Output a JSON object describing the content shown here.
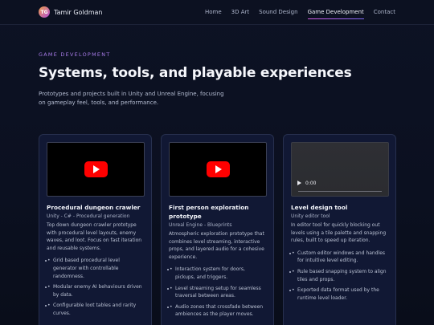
{
  "brand": {
    "initials": "TG",
    "name": "Tamir Goldman"
  },
  "nav": {
    "items": [
      {
        "label": "Home",
        "active": false
      },
      {
        "label": "3D Art",
        "active": false
      },
      {
        "label": "Sound Design",
        "active": false
      },
      {
        "label": "Game Development",
        "active": true
      },
      {
        "label": "Contact",
        "active": false
      }
    ]
  },
  "hero": {
    "eyebrow": "GAME DEVELOPMENT",
    "title": "Systems, tools, and playable experiences",
    "description": "Prototypes and projects built in Unity and Unreal Engine, focusing on gameplay feel, tools, and performance."
  },
  "cards": [
    {
      "media": "youtube-embed",
      "title": "Procedural dungeon crawler",
      "subtitle": "Unity - C# - Procedural generation",
      "description": "Top down dungeon crawler prototype with procedural level layouts, enemy waves, and loot. Focus on fast iteration and reusable systems.",
      "bullets": [
        "Grid based procedural level generator with controllable randomness.",
        "Modular enemy AI behaviours driven by data.",
        "Configurable loot tables and rarity curves."
      ]
    },
    {
      "media": "youtube-embed",
      "title": "First person exploration prototype",
      "subtitle": "Unreal Engine - Blueprints",
      "description": "Atmospheric exploration prototype that combines level streaming, interactive props, and layered audio for a cohesive experience.",
      "bullets": [
        "Interaction system for doors, pickups, and triggers.",
        "Level streaming setup for seamless traversal between areas.",
        "Audio zones that crossfade between ambiences as the player moves."
      ]
    },
    {
      "media": "html5-video",
      "video_time": "0:00",
      "title": "Level design tool",
      "subtitle": "Unity editor tool",
      "description": "In editor tool for quickly blocking out levels using a tile palette and snapping rules, built to speed up iteration.",
      "bullets": [
        "Custom editor windows and handles for intuitive level editing.",
        "Rule based snapping system to align tiles and props.",
        "Exported data format used by the runtime level loader."
      ]
    }
  ]
}
